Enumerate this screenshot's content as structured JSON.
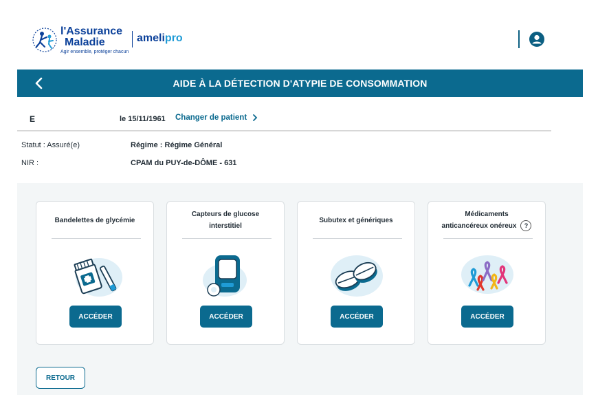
{
  "header": {
    "logo_name_line1": "l'Assurance",
    "logo_name_line2": "Maladie",
    "logo_tagline": "Agir ensemble, protéger chacun",
    "product_part1": "ameli",
    "product_part2": "pro",
    "user_icon": "user-icon"
  },
  "titlebar": {
    "back_icon": "chevron-left-icon",
    "title": "AIDE À LA DÉTECTION D'ATYPIE DE CONSOMMATION"
  },
  "patient": {
    "initial": "E",
    "dob": "le 15/11/1961",
    "change_label": "Changer de patient",
    "change_icon": "chevron-right-icon",
    "statut_label": "Statut : Assuré(e)",
    "nir_label": "NIR :",
    "regime_label": "Régime :",
    "regime_value": "Régime Général",
    "caisse": "CPAM du PUY-de-DÔME - 631"
  },
  "cards": [
    {
      "title": "Bandelettes de glycémie",
      "button": "ACCÉDER",
      "icon": "glucose-strips-icon"
    },
    {
      "title_line1": "Capteurs de glucose",
      "title_line2": "interstitiel",
      "button": "ACCÉDER",
      "icon": "glucose-sensor-icon"
    },
    {
      "title": "Subutex et génériques",
      "button": "ACCÉDER",
      "icon": "pills-icon"
    },
    {
      "title_line1": "Médicaments",
      "title_line2": "anticancéreux onéreux",
      "help": "?",
      "button": "ACCÉDER",
      "icon": "awareness-ribbons-icon"
    }
  ],
  "footer": {
    "back_button": "RETOUR"
  },
  "colors": {
    "primary": "#0b6a8f",
    "brand_blue": "#0c419a",
    "light_blue": "#1f9bd6",
    "panel_bg": "#f3f6f7"
  }
}
